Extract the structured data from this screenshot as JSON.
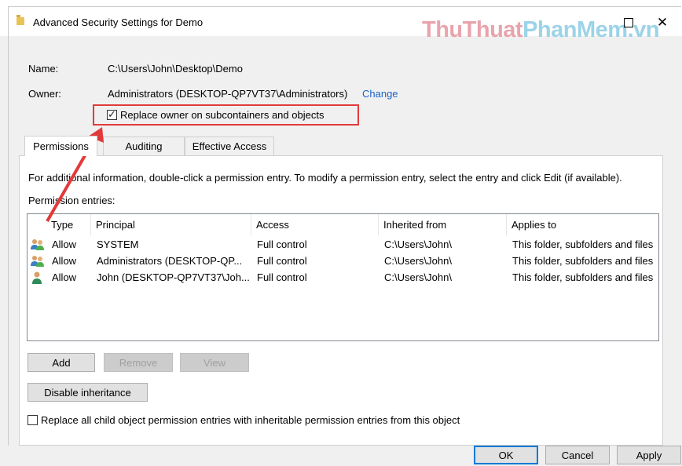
{
  "window": {
    "title": "Advanced Security Settings for Demo",
    "close_glyph": "✕"
  },
  "watermark": {
    "part1": "ThuThuat",
    "part2": "PhanMem",
    "part3": ".vn"
  },
  "info": {
    "name_label": "Name:",
    "name_value": "C:\\Users\\John\\Desktop\\Demo",
    "owner_label": "Owner:",
    "owner_value": "Administrators (DESKTOP-QP7VT37\\Administrators)",
    "change_link": "Change",
    "replace_owner_label": "Replace owner on subcontainers and objects",
    "replace_owner_checked": true
  },
  "tabs": [
    {
      "label": "Permissions",
      "active": true
    },
    {
      "label": "Auditing",
      "active": false
    },
    {
      "label": "Effective Access",
      "active": false
    }
  ],
  "permissions": {
    "info_text": "For additional information, double-click a permission entry. To modify a permission entry, select the entry and click Edit (if available).",
    "entries_label": "Permission entries:",
    "columns": [
      "Type",
      "Principal",
      "Access",
      "Inherited from",
      "Applies to"
    ],
    "rows": [
      {
        "icon": "group-users-icon",
        "type": "Allow",
        "principal": "SYSTEM",
        "access": "Full control",
        "inherited_from": "C:\\Users\\John\\",
        "applies_to": "This folder, subfolders and files"
      },
      {
        "icon": "group-users-icon",
        "type": "Allow",
        "principal": "Administrators (DESKTOP-QP...",
        "access": "Full control",
        "inherited_from": "C:\\Users\\John\\",
        "applies_to": "This folder, subfolders and files"
      },
      {
        "icon": "single-user-icon",
        "type": "Allow",
        "principal": "John (DESKTOP-QP7VT37\\Joh...",
        "access": "Full control",
        "inherited_from": "C:\\Users\\John\\",
        "applies_to": "This folder, subfolders and files"
      }
    ],
    "add_button": "Add",
    "remove_button": "Remove",
    "view_button": "View",
    "disable_inheritance_button": "Disable inheritance",
    "replace_child_label": "Replace all child object permission entries with inheritable permission entries from this object",
    "replace_child_checked": false
  },
  "footer": {
    "ok": "OK",
    "cancel": "Cancel",
    "apply": "Apply"
  },
  "colors": {
    "highlight_box": "#e23a3a",
    "link": "#1a63c8",
    "arrow": "#e23a3a",
    "default_button_border": "#0078d7"
  }
}
